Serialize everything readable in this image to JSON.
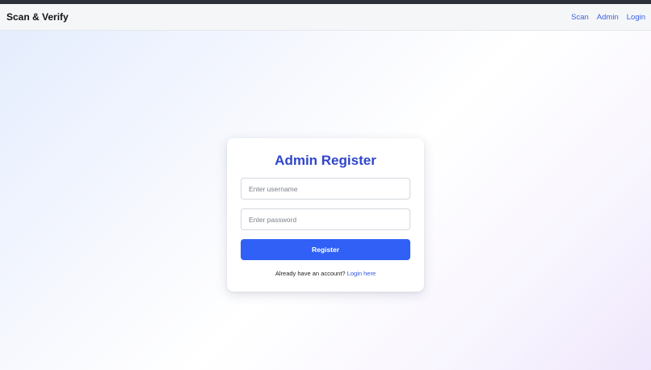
{
  "navbar": {
    "brand": "Scan & Verify",
    "links": [
      {
        "label": "Scan"
      },
      {
        "label": "Admin"
      },
      {
        "label": "Login"
      }
    ]
  },
  "register_card": {
    "title": "Admin Register",
    "username": {
      "value": "",
      "placeholder": "Enter username"
    },
    "password": {
      "value": "",
      "placeholder": "Enter password"
    },
    "submit_label": "Register",
    "footer_text": "Already have an account?",
    "footer_link": "Login here"
  },
  "colors": {
    "accent": "#3060f5",
    "title": "#2f45c8",
    "link": "#3a62e6"
  }
}
